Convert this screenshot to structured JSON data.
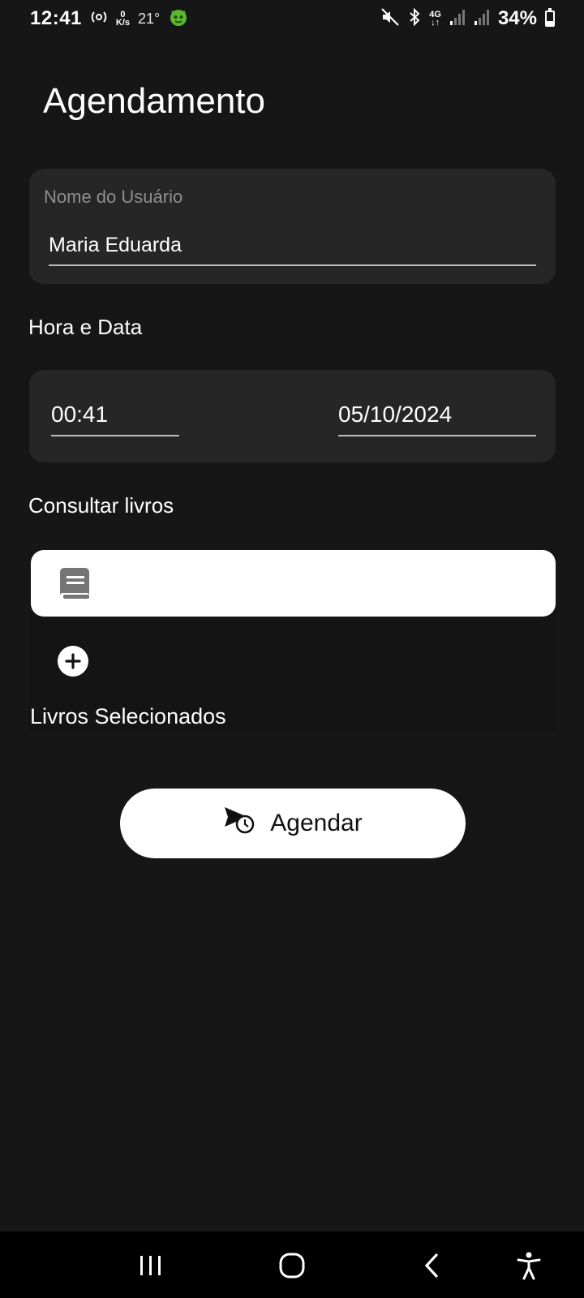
{
  "status_bar": {
    "time": "12:41",
    "net_speed_value": "0",
    "net_speed_unit": "K/s",
    "temperature": "21°",
    "network_type": "4G",
    "battery_text": "34%",
    "battery_level": 0.34
  },
  "page": {
    "title": "Agendamento"
  },
  "user_field": {
    "label": "Nome do Usuário",
    "value": "Maria Eduarda"
  },
  "datetime": {
    "section_label": "Hora e Data",
    "time": "00:41",
    "date": "05/10/2024"
  },
  "books": {
    "section_label": "Consultar livros",
    "search_value": "",
    "selected_label": "Livros Selecionados"
  },
  "actions": {
    "schedule_label": "Agendar"
  },
  "colors": {
    "background": "#161616",
    "card": "#262626",
    "button": "#ffffff"
  }
}
